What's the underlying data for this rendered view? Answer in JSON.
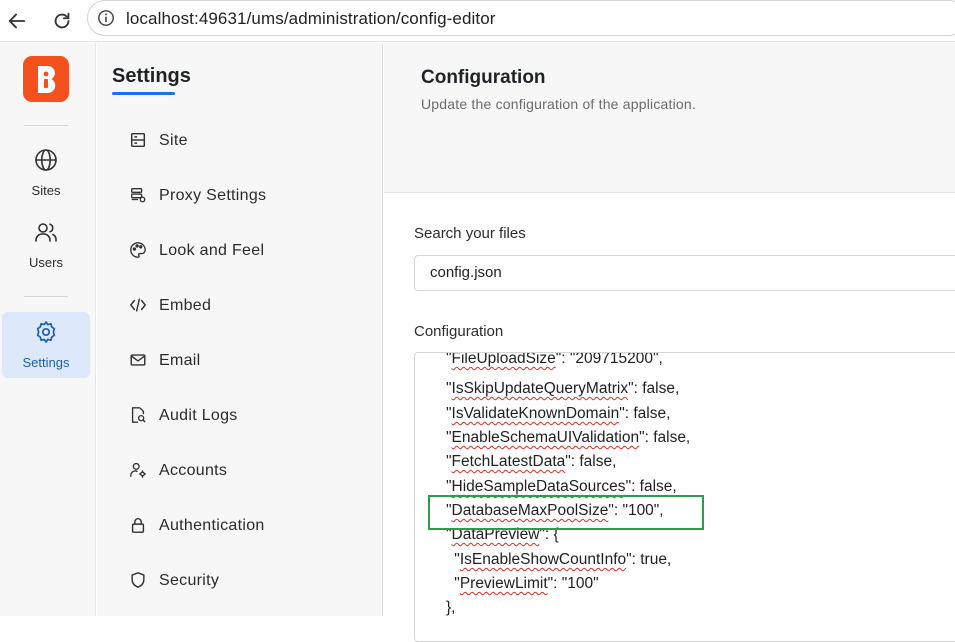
{
  "browser": {
    "url_host": "localhost",
    "url_rest": ":49631/ums/administration/config-editor"
  },
  "rail": {
    "items": [
      {
        "label": "Sites",
        "icon": "globe-icon"
      },
      {
        "label": "Users",
        "icon": "users-icon"
      },
      {
        "label": "Settings",
        "icon": "gear-icon"
      }
    ]
  },
  "menu": {
    "title": "Settings",
    "items": [
      {
        "label": "Site",
        "icon": "server-icon"
      },
      {
        "label": "Proxy Settings",
        "icon": "proxy-server-icon"
      },
      {
        "label": "Look and Feel",
        "icon": "palette-icon"
      },
      {
        "label": "Embed",
        "icon": "code-icon"
      },
      {
        "label": "Email",
        "icon": "mail-icon"
      },
      {
        "label": "Audit Logs",
        "icon": "document-search-icon"
      },
      {
        "label": "Accounts",
        "icon": "user-settings-icon"
      },
      {
        "label": "Authentication",
        "icon": "lock-icon"
      },
      {
        "label": "Security",
        "icon": "shield-icon"
      }
    ]
  },
  "main": {
    "title": "Configuration",
    "subtitle": "Update the configuration of the application.",
    "search_label": "Search your files",
    "search_value": "config.json",
    "config_label": "Configuration"
  },
  "editor": {
    "lines": [
      {
        "pre": "\"",
        "key": "FileUploadSize",
        "post": "\": \"209715200\","
      },
      {
        "pre": "\"",
        "key": "IsSkipUpdateQueryMatrix",
        "post": "\": false,"
      },
      {
        "pre": "\"",
        "key": "IsValidateKnownDomain",
        "post": "\": false,"
      },
      {
        "pre": "\"",
        "key": "EnableSchemaUIValidation",
        "post": "\": false,"
      },
      {
        "pre": "\"",
        "key": "FetchLatestData",
        "post": "\": false,"
      },
      {
        "pre": "\"",
        "key": "HideSampleDataSources",
        "post": "\": false,"
      },
      {
        "pre": "\"",
        "key": "DatabaseMaxPoolSize",
        "post": "\": \"100\","
      },
      {
        "pre": "\"",
        "key": "DataPreview",
        "post": "\": {"
      },
      {
        "pre": " \"",
        "key": "IsEnableShowCountInfo",
        "post": "\": true,"
      },
      {
        "pre": " \"",
        "key": "PreviewLimit",
        "post": "\": \"100\""
      },
      {
        "pre": "},",
        "key": "",
        "post": ""
      }
    ]
  },
  "colors": {
    "brand": "#f4511e",
    "accent": "#1a73e8",
    "highlight_border": "#2e9b4a"
  }
}
